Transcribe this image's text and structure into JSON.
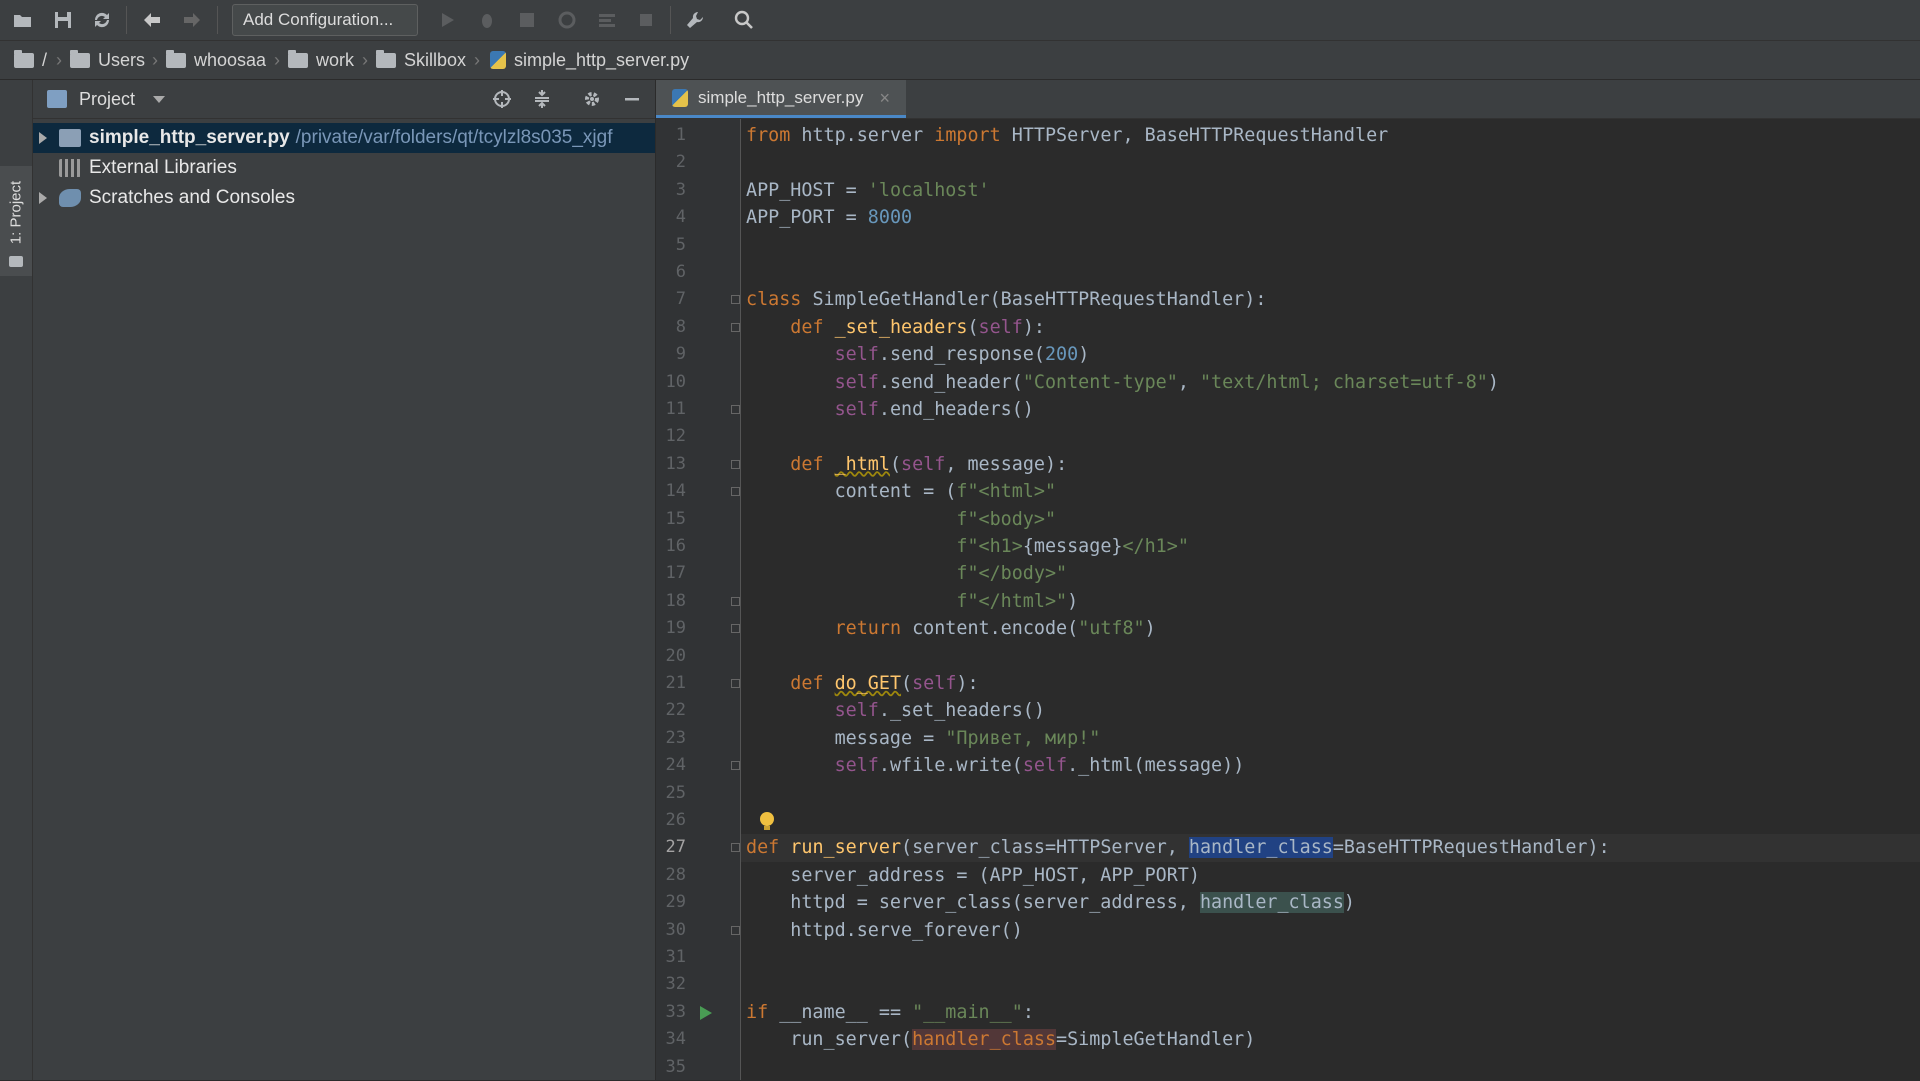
{
  "toolbar": {
    "run_config_label": "Add Configuration...",
    "icons": [
      "open-folder-icon",
      "save-icon",
      "sync-icon",
      "back-icon",
      "forward-icon",
      "run-icon",
      "debug-icon",
      "coverage-icon",
      "profile-icon",
      "concurrency-icon",
      "stop-icon",
      "settings-wrench-icon",
      "search-icon"
    ]
  },
  "breadcrumb": {
    "items": [
      "/",
      "Users",
      "whoosaa",
      "work",
      "Skillbox",
      "simple_http_server.py"
    ]
  },
  "tool_strip": {
    "project_label": "1: Project"
  },
  "project_panel": {
    "title": "Project",
    "tree": [
      {
        "name": "simple_http_server.py",
        "path": "/private/var/folders/qt/tcylzl8s035_xjgf",
        "expandable": true,
        "selected": true
      },
      {
        "name": "External Libraries",
        "path": "",
        "expandable": false,
        "selected": false
      },
      {
        "name": "Scratches and Consoles",
        "path": "",
        "expandable": true,
        "selected": false
      }
    ]
  },
  "editor": {
    "tab_label": "simple_http_server.py",
    "tab_close": "×",
    "current_line": 27,
    "line_numbers": [
      "1",
      "2",
      "3",
      "4",
      "5",
      "6",
      "7",
      "8",
      "9",
      "10",
      "11",
      "12",
      "13",
      "14",
      "15",
      "16",
      "17",
      "18",
      "19",
      "20",
      "21",
      "22",
      "23",
      "24",
      "25",
      "26",
      "27",
      "28",
      "29",
      "30",
      "31",
      "32",
      "33",
      "34",
      "35"
    ],
    "lines": [
      [
        [
          "kw",
          "from "
        ],
        [
          "",
          "http.server "
        ],
        [
          "kw",
          "import "
        ],
        [
          "",
          "HTTPServer, BaseHTTPRequestHandler"
        ]
      ],
      [],
      [
        [
          "",
          "APP_HOST = "
        ],
        [
          "str",
          "'localhost'"
        ]
      ],
      [
        [
          "",
          "APP_PORT = "
        ],
        [
          "num",
          "8000"
        ]
      ],
      [],
      [],
      [
        [
          "kw",
          "class "
        ],
        [
          "",
          "SimpleGetHandler(BaseHTTPRequestHandler):"
        ]
      ],
      [
        [
          "",
          "    "
        ],
        [
          "kw",
          "def "
        ],
        [
          "fn",
          "_set_headers"
        ],
        [
          "",
          "("
        ],
        [
          "self",
          "self"
        ],
        [
          "",
          "):"
        ]
      ],
      [
        [
          "",
          "        "
        ],
        [
          "self",
          "self"
        ],
        [
          "",
          ".send_response("
        ],
        [
          "num",
          "200"
        ],
        [
          "",
          ")"
        ]
      ],
      [
        [
          "",
          "        "
        ],
        [
          "self",
          "self"
        ],
        [
          "",
          ".send_header("
        ],
        [
          "str",
          "\"Content-type\""
        ],
        [
          "",
          ", "
        ],
        [
          "str",
          "\"text/html; charset=utf-8\""
        ],
        [
          "",
          ")"
        ]
      ],
      [
        [
          "",
          "        "
        ],
        [
          "self",
          "self"
        ],
        [
          "",
          ".end_headers()"
        ]
      ],
      [],
      [
        [
          "",
          "    "
        ],
        [
          "kw",
          "def "
        ],
        [
          "fn-u",
          "_html"
        ],
        [
          "",
          "("
        ],
        [
          "self",
          "self"
        ],
        [
          "",
          ", message):"
        ]
      ],
      [
        [
          "",
          "        content = ("
        ],
        [
          "str",
          "f\"<html>\""
        ]
      ],
      [
        [
          "",
          "                   "
        ],
        [
          "str",
          "f\"<body>\""
        ]
      ],
      [
        [
          "",
          "                   "
        ],
        [
          "str",
          "f\"<h1>"
        ],
        [
          "",
          "{message}"
        ],
        [
          "str",
          "</h1>\""
        ]
      ],
      [
        [
          "",
          "                   "
        ],
        [
          "str",
          "f\"</body>\""
        ]
      ],
      [
        [
          "",
          "                   "
        ],
        [
          "str",
          "f\"</html>\""
        ],
        [
          "",
          ")"
        ]
      ],
      [
        [
          "",
          "        "
        ],
        [
          "kw",
          "return "
        ],
        [
          "",
          "content.encode("
        ],
        [
          "str",
          "\"utf8\""
        ],
        [
          "",
          ")"
        ]
      ],
      [],
      [
        [
          "",
          "    "
        ],
        [
          "kw",
          "def "
        ],
        [
          "fn-u",
          "do_GET"
        ],
        [
          "",
          "("
        ],
        [
          "self",
          "self"
        ],
        [
          "",
          "):"
        ]
      ],
      [
        [
          "",
          "        "
        ],
        [
          "self",
          "self"
        ],
        [
          "",
          "._set_headers()"
        ]
      ],
      [
        [
          "",
          "        message = "
        ],
        [
          "str",
          "\"Привет, мир!\""
        ]
      ],
      [
        [
          "",
          "        "
        ],
        [
          "self",
          "self"
        ],
        [
          "",
          ".wfile.write("
        ],
        [
          "self",
          "self"
        ],
        [
          "",
          "._html(message))"
        ]
      ],
      [],
      [],
      [
        [
          "kw",
          "def "
        ],
        [
          "fn",
          "run_server"
        ],
        [
          "",
          "(server_class=HTTPServer, "
        ],
        [
          "hl-sel",
          "handler_class"
        ],
        [
          "",
          "=BaseHTTPRequestHandler):"
        ]
      ],
      [
        [
          "",
          "    server_address = (APP_HOST, APP_PORT)"
        ]
      ],
      [
        [
          "",
          "    httpd = server_class(server_address, "
        ],
        [
          "hl-usage",
          "handler_class"
        ],
        [
          "",
          ")"
        ]
      ],
      [
        [
          "",
          "    httpd.serve_forever()"
        ]
      ],
      [],
      [],
      [
        [
          "kw",
          "if "
        ],
        [
          "",
          "__name__ == "
        ],
        [
          "str",
          "\"__main__\""
        ],
        [
          "",
          ":"
        ]
      ],
      [
        [
          "",
          "    run_server("
        ],
        [
          "hl-param",
          "handler_class"
        ],
        [
          "",
          "=SimpleGetHandler)"
        ]
      ],
      []
    ],
    "colors": {
      "keyword": "#cc7832",
      "string": "#6a8759",
      "number": "#6897bb",
      "self": "#94558d",
      "function": "#ffc66d",
      "default": "#a9b7c6",
      "selection": "#214283"
    }
  }
}
